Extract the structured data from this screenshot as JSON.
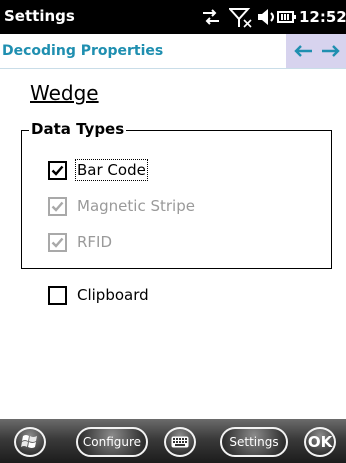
{
  "status_bar": {
    "title": "Settings",
    "time": "12:52",
    "icons": [
      "connectivity-icon",
      "no-signal-icon",
      "speaker-icon",
      "battery-icon"
    ]
  },
  "header": {
    "title": "Decoding Properties",
    "nav_back_icon": "arrow-left-icon",
    "nav_forward_icon": "arrow-right-icon",
    "accent_color": "#1f8fb0",
    "nav_bg_color": "#d7d3ee"
  },
  "content": {
    "section_link": "Wedge",
    "group": {
      "legend": "Data Types",
      "items": [
        {
          "label": "Bar Code",
          "checked": true,
          "enabled": true,
          "focused": true
        },
        {
          "label": "Magnetic Stripe",
          "checked": true,
          "enabled": false,
          "focused": false
        },
        {
          "label": "RFID",
          "checked": true,
          "enabled": false,
          "focused": false
        }
      ]
    },
    "clipboard": {
      "label": "Clipboard",
      "checked": false,
      "enabled": true
    }
  },
  "softkeys": {
    "start_icon": "windows-start-icon",
    "configure": "Configure",
    "keyboard_icon": "keyboard-icon",
    "settings": "Settings",
    "ok": "OK"
  }
}
